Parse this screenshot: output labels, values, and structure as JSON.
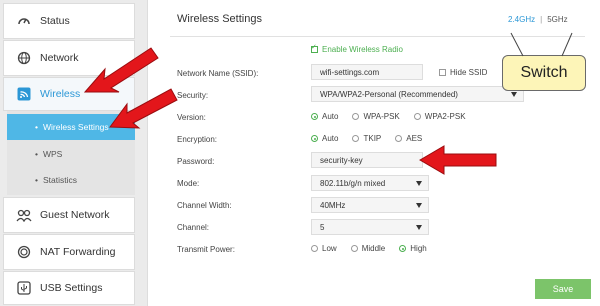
{
  "sidebar": {
    "items": [
      {
        "label": "Status",
        "icon": "gauge-icon"
      },
      {
        "label": "Network",
        "icon": "globe-icon"
      },
      {
        "label": "Wireless",
        "icon": "wifi-icon"
      },
      {
        "label": "Guest Network",
        "icon": "users-icon"
      },
      {
        "label": "NAT Forwarding",
        "icon": "refresh-icon"
      },
      {
        "label": "USB Settings",
        "icon": "usb-icon"
      }
    ],
    "submenu": [
      {
        "label": "Wireless Settings"
      },
      {
        "label": "WPS"
      },
      {
        "label": "Statistics"
      }
    ]
  },
  "main": {
    "title": "Wireless Settings",
    "band_24": "2.4GHz",
    "band_sep": "|",
    "band_5": "5GHz",
    "enable_label": "Enable Wireless Radio",
    "ssid_label": "Network Name (SSID):",
    "ssid_value": "wifi-settings.com",
    "hide_ssid_label": "Hide SSID",
    "security_label": "Security:",
    "security_value": "WPA/WPA2-Personal (Recommended)",
    "version_label": "Version:",
    "version_options": [
      "Auto",
      "WPA-PSK",
      "WPA2-PSK"
    ],
    "encryption_label": "Encryption:",
    "encryption_options": [
      "Auto",
      "TKIP",
      "AES"
    ],
    "password_label": "Password:",
    "password_value": "security-key",
    "mode_label": "Mode:",
    "mode_value": "802.11b/g/n mixed",
    "width_label": "Channel Width:",
    "width_value": "40MHz",
    "channel_label": "Channel:",
    "channel_value": "5",
    "power_label": "Transmit Power:",
    "power_options": [
      "Low",
      "Middle",
      "High"
    ],
    "save_label": "Save"
  },
  "annotation": {
    "callout_text": "Switch"
  },
  "colors": {
    "accent": "#2b97d6",
    "highlight": "#4fb7e6",
    "green": "#4caf50",
    "save": "#7cc46a",
    "arrow": "#e3161b"
  }
}
